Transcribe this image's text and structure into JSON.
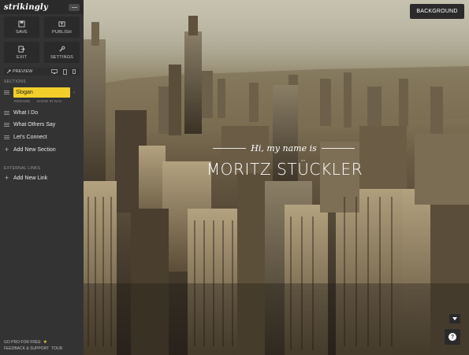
{
  "app": {
    "logo_text": "strikingly"
  },
  "toolbar": {
    "buttons": [
      {
        "label": "SAVE",
        "icon": "save-icon"
      },
      {
        "label": "PUBLISH",
        "icon": "publish-icon"
      },
      {
        "label": "EXIT",
        "icon": "exit-icon"
      },
      {
        "label": "SETTINGS",
        "icon": "settings-icon"
      }
    ],
    "preview_label": "PREVIEW"
  },
  "sidebar": {
    "sections_label": "SECTIONS",
    "slogan": {
      "value": "Slogan",
      "rename": "RENAME",
      "show_in_nav": "SHOW IN NAV"
    },
    "items": [
      {
        "label": "What I Do"
      },
      {
        "label": "What Others Say"
      },
      {
        "label": "Let's Connect"
      }
    ],
    "add_section": "Add New Section",
    "external_links_label": "EXTERNAL LINKS",
    "add_link": "Add New Link",
    "footer": {
      "go_pro": "GO PRO FOR FREE",
      "feedback": "FEEDBACK & SUPPORT",
      "tour": "TOUR"
    }
  },
  "hero": {
    "background_button": "BACKGROUND",
    "subtitle": "Hi, my name is",
    "title": "MORITZ STÜCKLER"
  },
  "colors": {
    "accent": "#f3cf2a",
    "sidebar_bg": "#333333",
    "dark_button": "#2b2b2b"
  }
}
